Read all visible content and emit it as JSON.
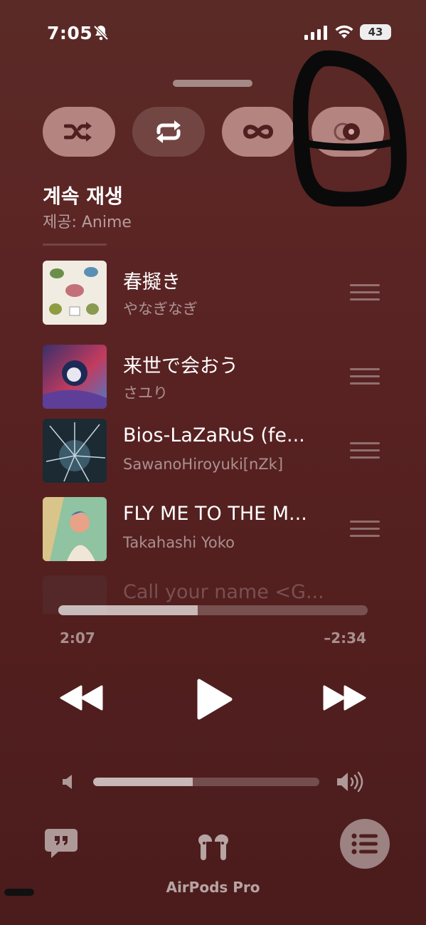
{
  "status_bar": {
    "time": "7:05",
    "battery": "43"
  },
  "controls": [
    {
      "name": "shuffle",
      "icon": "shuffle-icon",
      "active": true
    },
    {
      "name": "repeat",
      "icon": "repeat-icon",
      "active": false
    },
    {
      "name": "infinity",
      "icon": "infinity-icon",
      "active": true
    },
    {
      "name": "autoplay",
      "icon": "autoplay-icon",
      "active": true
    }
  ],
  "section": {
    "title": "계속 재생",
    "subtitle": "제공: Anime"
  },
  "queue": [
    {
      "title": "春擬き",
      "artist": "やなぎなぎ"
    },
    {
      "title": "来世で会おう",
      "artist": "さユり"
    },
    {
      "title": "Bios-LaZaRuS (fe...",
      "artist": "SawanoHiroyuki[nZk]"
    },
    {
      "title": "FLY ME TO THE M...",
      "artist": "Takahashi Yoko"
    },
    {
      "title": "Call your name <G..."
    }
  ],
  "playback": {
    "elapsed": "2:07",
    "remaining": "–2:34",
    "progress": 0.45
  },
  "volume": {
    "level": 0.44
  },
  "bottom": {
    "airplay_label": "AirPods Pro"
  },
  "colors": {
    "background": "#5b2424",
    "accent_pill": "#d9a9a6"
  }
}
